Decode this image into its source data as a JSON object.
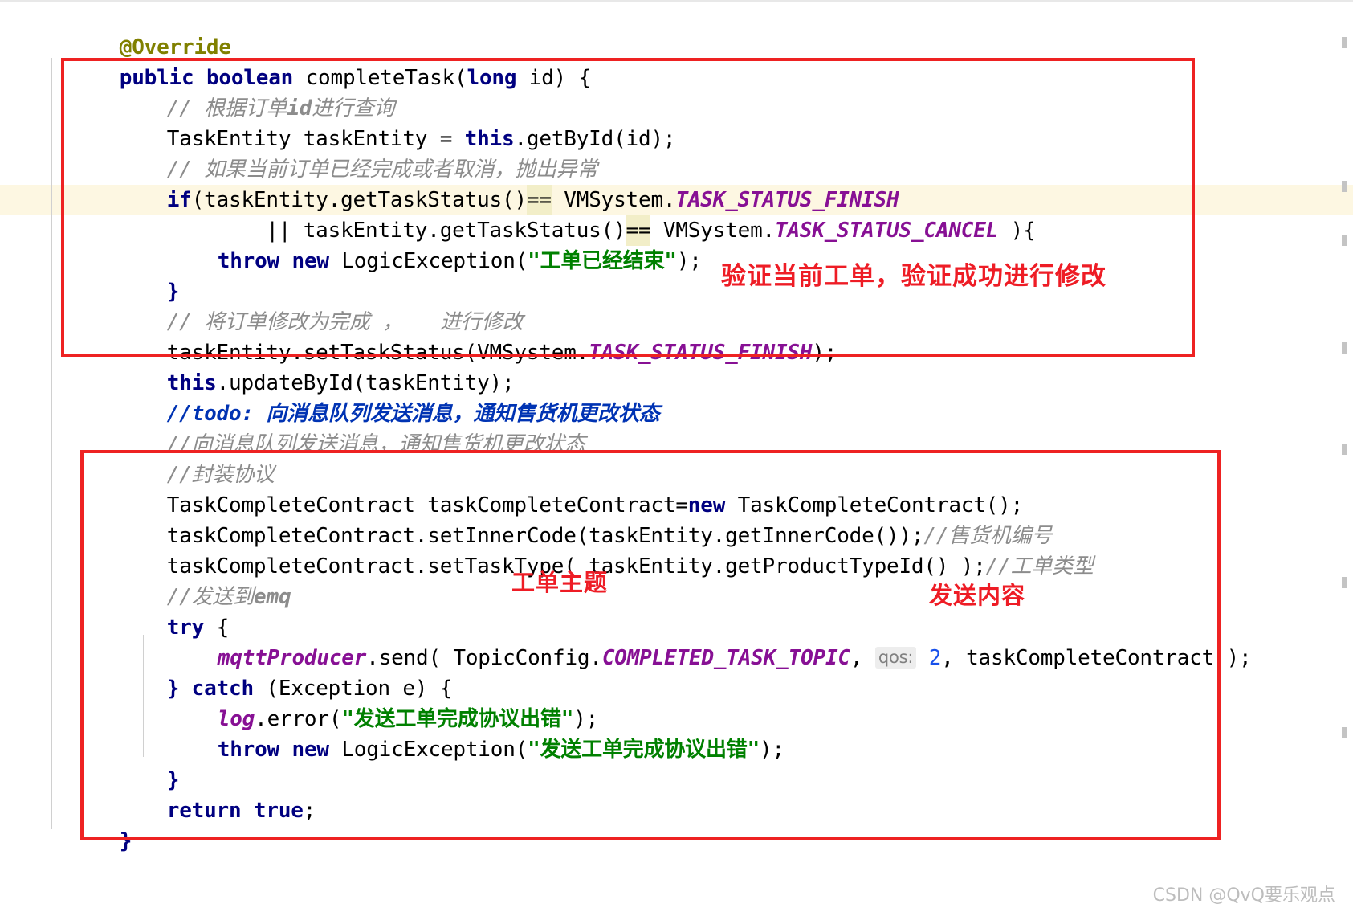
{
  "editor": {
    "language": "java",
    "caret_line_index": 5,
    "colors": {
      "keyword": "#000080",
      "annotation": "#808000",
      "comment": "#8c8c8c",
      "todo": "#0033b3",
      "string": "#008000",
      "static_constant": "#871094",
      "number": "#1750eb",
      "operator_highlight": "#f2eec8",
      "caret_line_background": "#fdf7e2",
      "annotation_red": "#ee1c25",
      "parameter_hint_background": "#ededed"
    },
    "code_lines": [
      "@Override",
      "public boolean completeTask(long id) {",
      "    // 根据订单id进行查询",
      "    TaskEntity taskEntity = this.getById(id);",
      "    // 如果当前订单已经完成或者取消，抛出异常",
      "    if(taskEntity.getTaskStatus()== VMSystem.TASK_STATUS_FINISH",
      "            || taskEntity.getTaskStatus()== VMSystem.TASK_STATUS_CANCEL ){",
      "        throw new LogicException(\"工单已经结束\");",
      "    }",
      "    // 将订单修改为完成 ， 进行修改",
      "    taskEntity.setTaskStatus(VMSystem.TASK_STATUS_FINISH);",
      "    this.updateById(taskEntity);",
      "    //todo: 向消息队列发送消息，通知售货机更改状态",
      "    //向消息队列发送消息，通知售货机更改状态",
      "    //封装协议",
      "    TaskCompleteContract taskCompleteContract=new TaskCompleteContract();",
      "    taskCompleteContract.setInnerCode(taskEntity.getInnerCode());//售货机编号",
      "    taskCompleteContract.setTaskType( taskEntity.getProductTypeId() );//工单类型",
      "    //发送到emq",
      "    try {",
      "        mqttProducer.send( TopicConfig.COMPLETED_TASK_TOPIC, qos: 2, taskCompleteContract );",
      "    } catch (Exception e) {",
      "        log.error(\"发送工单完成协议出错\");",
      "        throw new LogicException(\"发送工单完成协议出错\");",
      "    }",
      "    return true;",
      "}"
    ],
    "tokens": {
      "annotation_override": "@Override",
      "kw_public": "public",
      "kw_boolean": "boolean",
      "method_completeTask": " completeTask(",
      "kw_long": "long",
      "param_id": " id) {",
      "comment_query_by_order_id_a": "// ",
      "comment_query_by_order_id_b": "根据订单",
      "comment_query_by_order_id_c": "id",
      "comment_query_by_order_id_d": "进行查询",
      "line_getById_a": "TaskEntity taskEntity = ",
      "kw_this": "this",
      "line_getById_b": ".getById(id);",
      "comment_if_finished": "// 如果当前订单已经完成或者取消，抛出异常",
      "kw_if": "if",
      "if_cond_a": "(taskEntity.getTaskStatus()",
      "op_eqeq": "==",
      "if_cond_b": " VMSystem.",
      "const_task_status_finish": "TASK_STATUS_FINISH",
      "or_cond_a": "        || taskEntity.getTaskStatus()",
      "or_cond_b": " VMSystem.",
      "const_task_status_cancel": "TASK_STATUS_CANCEL",
      "or_cond_c": " ){",
      "kw_throw": "throw",
      "kw_new": "new",
      "logic_exception_open": " LogicException(",
      "str_task_finished": "\"工单已经结束\"",
      "logic_exception_close": ");",
      "brace_close": "}",
      "comment_update_order": "// 将订单修改为完成 ，   进行修改",
      "set_status_a": "taskEntity.setTaskStatus(VMSystem.",
      "set_status_const": "TASK_STATUS_FINISH",
      "set_status_b": ");",
      "update_by_id": ".updateById(taskEntity);",
      "todo_prefix": "//todo: ",
      "todo_text": "向消息队列发送消息，通知售货机更改状态",
      "comment_send_mq": "//向消息队列发送消息，通知售货机更改状态",
      "comment_wrap_protocol": "//封装协议",
      "contract_decl_a": "TaskCompleteContract taskCompleteContract=",
      "contract_decl_b": " TaskCompleteContract();",
      "set_inner_code": "taskCompleteContract.setInnerCode(taskEntity.getInnerCode());",
      "comment_inner_code": "//售货机编号",
      "set_task_type": "taskCompleteContract.setTaskType( taskEntity.getProductTypeId() );",
      "comment_task_type": "//工单类型",
      "comment_send_emq_a": "//发送到",
      "comment_send_emq_b": "emq",
      "kw_try": "try",
      "try_brace": " {",
      "field_mqtt_producer": "mqttProducer",
      "send_call_a": ".send( TopicConfig.",
      "const_completed_task_topic": "COMPLETED_TASK_TOPIC",
      "send_comma": ", ",
      "hint_qos": "qos:",
      "num_two": "2",
      "send_call_b": ", taskCompleteContract );",
      "catch_brace_open": "} ",
      "kw_catch": "catch",
      "catch_params": " (Exception e) {",
      "field_log": "log",
      "log_error_open": ".error(",
      "str_send_error": "\"发送工单完成协议出错\"",
      "log_error_close": ");",
      "throw_error_open": " LogicException(",
      "str_send_error2": "\"发送工单完成协议出错\"",
      "throw_error_close": ");",
      "kw_return": "return",
      "kw_true": " true",
      "return_semicolon": ";",
      "method_close_brace": "}"
    }
  },
  "annotations": {
    "boxes": [
      {
        "name": "validate-block",
        "label": "验证当前工单，验证成功进行修改"
      },
      {
        "name": "send-message-block",
        "label": ""
      }
    ],
    "label_verify": "验证当前工单，验证成功进行修改",
    "label_topic": "工单主题",
    "label_body": "发送内容"
  },
  "watermark": {
    "text": "CSDN @QvQ要乐观点"
  }
}
